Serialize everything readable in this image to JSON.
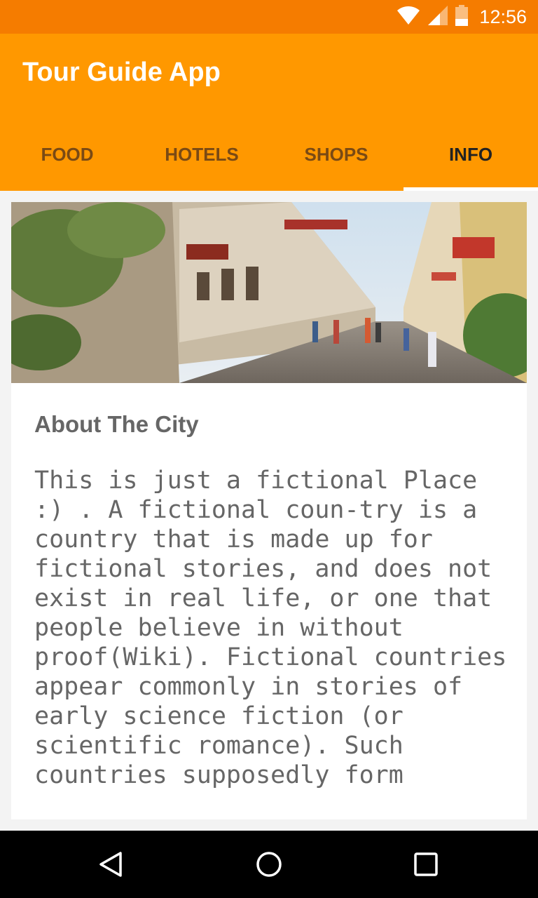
{
  "status_bar": {
    "time": "12:56",
    "icons": [
      "wifi-icon",
      "cellular-signal-icon",
      "battery-icon"
    ]
  },
  "app_bar": {
    "title": "Tour Guide App"
  },
  "tabs": [
    {
      "label": "FOOD",
      "active": false
    },
    {
      "label": "HOTELS",
      "active": false
    },
    {
      "label": "SHOPS",
      "active": false
    },
    {
      "label": "INFO",
      "active": true
    }
  ],
  "content": {
    "image": "street-photo",
    "section_title": "About The City",
    "body": "This is just a fictional Place :) . A fictional coun-try is a country that is made up for fictional stories, and does not exist in real life, or one that people believe in without proof(Wiki). Fictional countries appear commonly in stories of early science fiction (or scientific romance). Such countries supposedly form"
  },
  "nav_bar": {
    "buttons": [
      "back-icon",
      "home-icon",
      "recents-icon"
    ]
  },
  "colors": {
    "status_bar": "#F57C00",
    "app_bar": "#FF9800",
    "tab_inactive": "#7a4a14",
    "tab_active": "#222222",
    "text": "#666666"
  }
}
